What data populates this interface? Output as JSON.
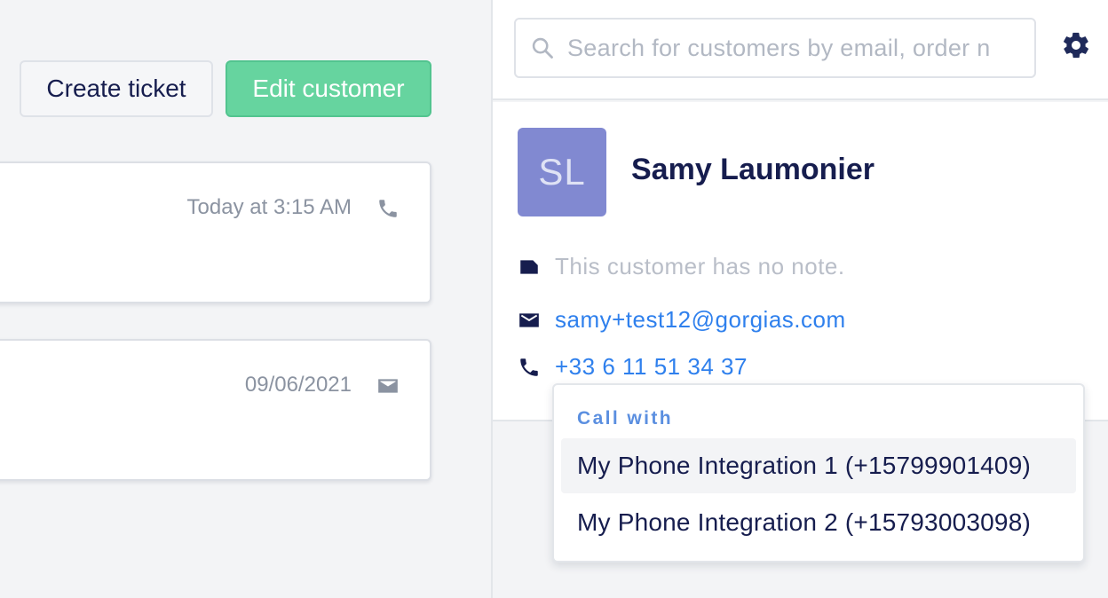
{
  "left_pane": {
    "actions": {
      "create_ticket": "Create ticket",
      "edit_customer": "Edit customer"
    },
    "tickets": [
      {
        "date": "Today at 3:15 AM",
        "channel_icon": "phone-icon"
      },
      {
        "date": "09/06/2021",
        "channel_icon": "email-icon"
      }
    ]
  },
  "right_pane": {
    "search": {
      "placeholder": "Search for customers by email, order n",
      "icon": "search-icon"
    },
    "settings_icon": "gear-icon",
    "customer": {
      "initials": "SL",
      "name": "Samy Laumonier",
      "note": "This customer has no note.",
      "email": "samy+test12@gorgias.com",
      "phone": "+33 6 11 51 34 37"
    },
    "call_menu": {
      "header": "Call with",
      "options": [
        "My Phone Integration 1 (+15799901409)",
        "My Phone Integration 2 (+15793003098)"
      ]
    }
  },
  "colors": {
    "primary_green": "#66d49f",
    "link_blue": "#2f80ed",
    "avatar_purple": "#8189d1",
    "text_navy": "#161d4e"
  }
}
